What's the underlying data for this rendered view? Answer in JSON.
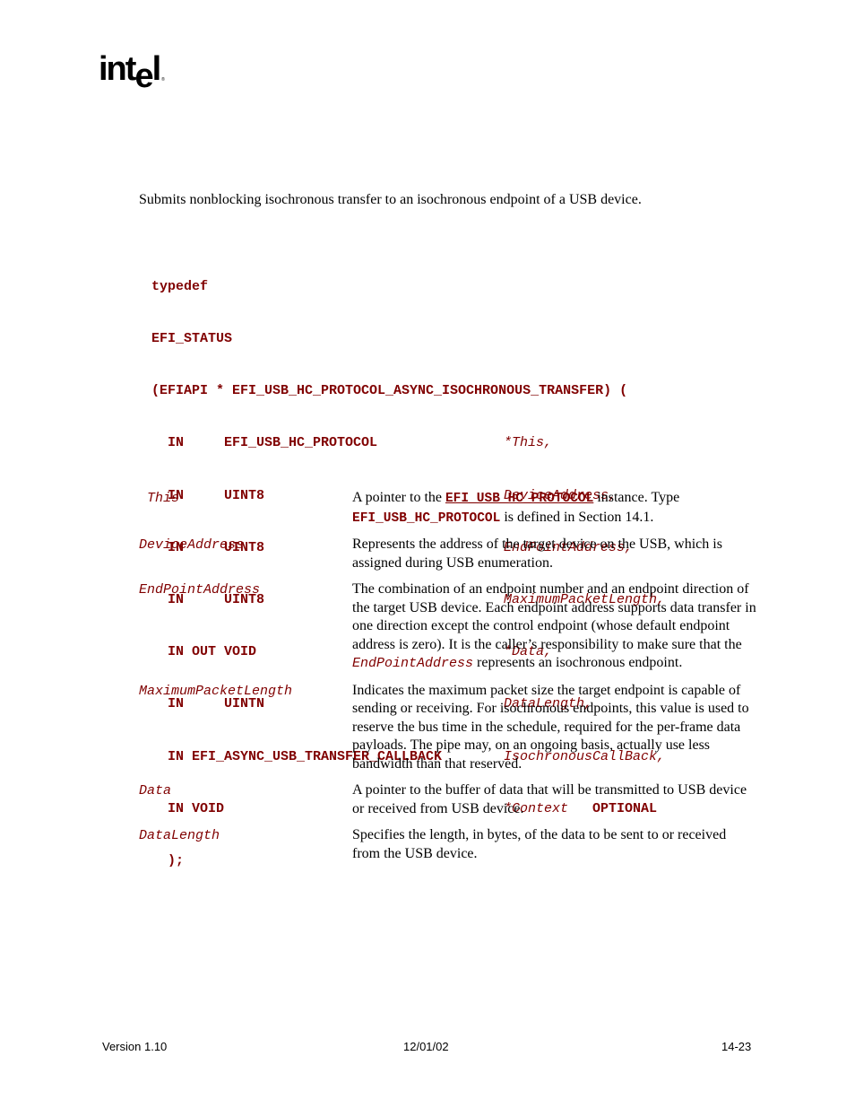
{
  "header": {
    "logo_text_a": "int",
    "logo_text_e": "e",
    "logo_text_l": "l",
    "logo_reg": "®"
  },
  "summary": "Submits nonblocking isochronous transfer to an isochronous endpoint of a USB device.",
  "prototype": {
    "lines": [
      {
        "kw": "typedef",
        "param": ""
      },
      {
        "kw": "EFI_STATUS",
        "param": ""
      },
      {
        "kw": "(EFIAPI * EFI_USB_HC_PROTOCOL_ASYNC_ISOCHRONOUS_TRANSFER) (",
        "param": ""
      },
      {
        "kw": "  IN     EFI_USB_HC_PROTOCOL",
        "param": "*This,"
      },
      {
        "kw": "  IN     UINT8",
        "param": "DeviceAddress,"
      },
      {
        "kw": "  IN     UINT8",
        "param": "EndPointAddress,"
      },
      {
        "kw": "  IN     UINT8",
        "param": "MaximumPacketLength,"
      },
      {
        "kw": "  IN OUT VOID",
        "param": "*Data,"
      },
      {
        "kw": "  IN     UINTN",
        "param": "DataLength,"
      },
      {
        "kw": "  IN EFI_ASYNC_USB_TRANSFER_CALLBACK",
        "param": "IsochronousCallBack,"
      },
      {
        "kw": "  IN VOID",
        "param": "*Context",
        "optional": "OPTIONAL"
      },
      {
        "kw": "  );",
        "param": ""
      }
    ]
  },
  "parameters": [
    {
      "name": " This",
      "desc_a": "A pointer to the ",
      "ref1": "EFI_USB_HC_PROTOCOL",
      "desc_b": " instance.  Type ",
      "ref2": "EFI_USB_HC_PROTOCOL",
      "desc_c": " is defined in Section 14.1."
    },
    {
      "name": "DeviceAddress",
      "desc": "Represents the address of the target device on the USB, which is assigned during USB enumeration."
    },
    {
      "name": "EndPointAddress",
      "desc": "The combination of an endpoint number and an endpoint direction of the target USB device.  Each endpoint address supports data transfer in one direction except the control endpoint (whose default endpoint address is zero).  It is the caller’s responsibility to make sure that the",
      "iref": "EndPointAddress",
      "desc_tail": " represents an isochronous endpoint."
    },
    {
      "name": "MaximumPacketLength",
      "desc": "Indicates the maximum packet size the target endpoint is capable of sending or receiving.  For isochronous endpoints, this value is used to reserve the bus time in the schedule, required for the per-frame data payloads.  The pipe may, on an ongoing basis, actually use less bandwidth than that reserved."
    },
    {
      "name": "Data",
      "desc": "A pointer to the buffer of data that will be transmitted to USB device or received from USB device."
    },
    {
      "name": "DataLength",
      "desc": "Specifies the length, in bytes, of the data to be sent to or received from the USB device."
    }
  ],
  "footer": {
    "version": "Version 1.10",
    "date": "12/01/02",
    "page": "14-23"
  }
}
